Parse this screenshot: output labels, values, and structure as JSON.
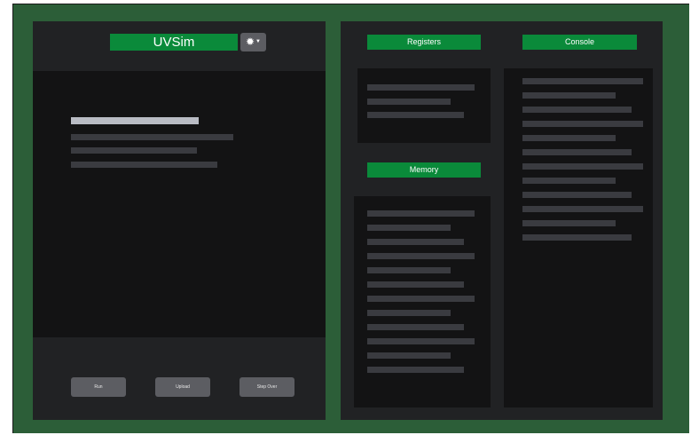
{
  "app": {
    "title": "UVSim",
    "theme_icon": "sun-icon"
  },
  "left": {
    "editor_lines": [
      {
        "highlight": true
      },
      {
        "highlight": false
      },
      {
        "highlight": false
      },
      {
        "highlight": false
      }
    ],
    "buttons": {
      "run_label": "Run",
      "upload_label": "Upload",
      "step_over_label": "Step Over"
    }
  },
  "right": {
    "registers_title": "Registers",
    "memory_title": "Memory",
    "console_title": "Console"
  },
  "colors": {
    "accent": "#0a8a3a",
    "background": "#2c5e38",
    "panel": "#212224",
    "inner": "#131314",
    "button": "#5c5d62",
    "placeholder": "#3a3b40"
  }
}
